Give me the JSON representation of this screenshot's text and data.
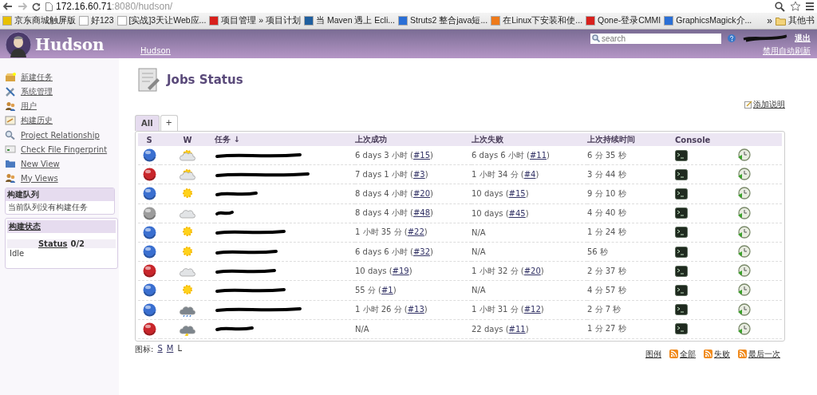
{
  "browser": {
    "url_host": "172.16.60.71",
    "url_rest": ":8080/hudson/",
    "bookmarks": [
      {
        "label": "京东商城触屏版",
        "kind": "color"
      },
      {
        "label": "好123",
        "kind": "page"
      },
      {
        "label": "[实战]3天让Web应...",
        "kind": "page"
      },
      {
        "label": "项目管理 » 项目计划",
        "kind": "red"
      },
      {
        "label": "当 Maven 遇上 Ecli...",
        "kind": "ibm"
      },
      {
        "label": "Struts2 整合java短...",
        "kind": "blue"
      },
      {
        "label": "在Linux下安装和使...",
        "kind": "orange"
      },
      {
        "label": "Qone-登录CMMI",
        "kind": "red"
      },
      {
        "label": "GraphicsMagick介...",
        "kind": "blue"
      }
    ],
    "more": "»",
    "other": "其他书"
  },
  "header": {
    "logo": "Hudson",
    "breadcrumb": "Hudson",
    "search_placeholder": "search",
    "logout": "退出",
    "auto_refresh": "禁用自动刷新"
  },
  "sidebar": {
    "items": [
      {
        "label": "新建任务",
        "kind": "box"
      },
      {
        "label": "系统管理",
        "kind": "tools"
      },
      {
        "label": "用户",
        "kind": "users"
      },
      {
        "label": "构建历史",
        "kind": "notepad"
      },
      {
        "label": "Project Relationship",
        "kind": "search"
      },
      {
        "label": "Check File Fingerprint",
        "kind": "fingerprint"
      },
      {
        "label": "New View",
        "kind": "folder"
      },
      {
        "label": "My Views",
        "kind": "users"
      }
    ],
    "queue": {
      "title": "构建队列",
      "text": "当前队列没有构建任务"
    },
    "executors": {
      "title": "构建状态",
      "status_link": "Status",
      "status_count": "0/2",
      "state": "Idle"
    }
  },
  "main": {
    "title": "Jobs Status",
    "add_description": "添加说明",
    "tabs": [
      {
        "label": "All",
        "selected": true
      },
      {
        "label": "+",
        "selected": false
      }
    ],
    "columns": [
      "S",
      "W",
      "任务 ↓",
      "上次成功",
      "上次失败",
      "上次持续时间",
      "Console"
    ],
    "rows": [
      {
        "color": "#3a6fd0",
        "kind": "partly",
        "success": {
          "pre": "6 days 3 小时 (",
          "link": "#15",
          "post": ")"
        },
        "failure": {
          "pre": "6 days 6 小时 (",
          "link": "#11",
          "post": ")"
        },
        "duration": "6 分 35 秒"
      },
      {
        "color": "#c8262b",
        "kind": "partly",
        "success": {
          "pre": "7 days 1 小时 (",
          "link": "#3",
          "post": ")"
        },
        "failure": {
          "pre": "1 小时 34 分 (",
          "link": "#4",
          "post": ")"
        },
        "duration": "3 分 44 秒"
      },
      {
        "color": "#3a6fd0",
        "kind": "sunny",
        "success": {
          "pre": "8 days 4 小时 (",
          "link": "#20",
          "post": ")"
        },
        "failure": {
          "pre": "10 days (",
          "link": "#15",
          "post": ")"
        },
        "duration": "9 分 10 秒"
      },
      {
        "color": "#9c9c9c",
        "kind": "cloudy",
        "success": {
          "pre": "8 days 4 小时 (",
          "link": "#48",
          "post": ")"
        },
        "failure": {
          "pre": "10 days (",
          "link": "#45",
          "post": ")"
        },
        "duration": "4 分 40 秒"
      },
      {
        "color": "#3a6fd0",
        "kind": "sunny",
        "success": {
          "pre": "1 小时 35 分 (",
          "link": "#22",
          "post": ")"
        },
        "failure": {
          "pre": "N/A"
        },
        "duration": "1 分 24 秒"
      },
      {
        "color": "#3a6fd0",
        "kind": "sunny",
        "success": {
          "pre": "6 days 6 小时 (",
          "link": "#32",
          "post": ")"
        },
        "failure": {
          "pre": "N/A"
        },
        "duration": "56 秒"
      },
      {
        "color": "#c8262b",
        "kind": "cloudy",
        "success": {
          "pre": "10 days (",
          "link": "#19",
          "post": ")"
        },
        "failure": {
          "pre": "1 小时 32 分 (",
          "link": "#20",
          "post": ")"
        },
        "duration": "2 分 37 秒"
      },
      {
        "color": "#3a6fd0",
        "kind": "sunny",
        "success": {
          "pre": "55 分 (",
          "link": "#1",
          "post": ")"
        },
        "failure": {
          "pre": "N/A"
        },
        "duration": "4 分 57 秒"
      },
      {
        "color": "#3a6fd0",
        "kind": "rain",
        "success": {
          "pre": "1 小时 26 分 (",
          "link": "#13",
          "post": ")"
        },
        "failure": {
          "pre": "1 小时 31 分 (",
          "link": "#12",
          "post": ")"
        },
        "duration": "2 分 7 秒"
      },
      {
        "color": "#c8262b",
        "kind": "storm",
        "success": {
          "pre": "N/A"
        },
        "failure": {
          "pre": "22 days (",
          "link": "#11",
          "post": ")"
        },
        "duration": "1 分 27 秒"
      }
    ],
    "icon_size_label": "图标:",
    "icon_sizes": [
      {
        "label": "S",
        "selected": false
      },
      {
        "label": "M",
        "selected": false
      },
      {
        "label": "L",
        "selected": true
      }
    ],
    "legend": "图例",
    "feeds": [
      "全部",
      "失败",
      "最后一次"
    ]
  }
}
